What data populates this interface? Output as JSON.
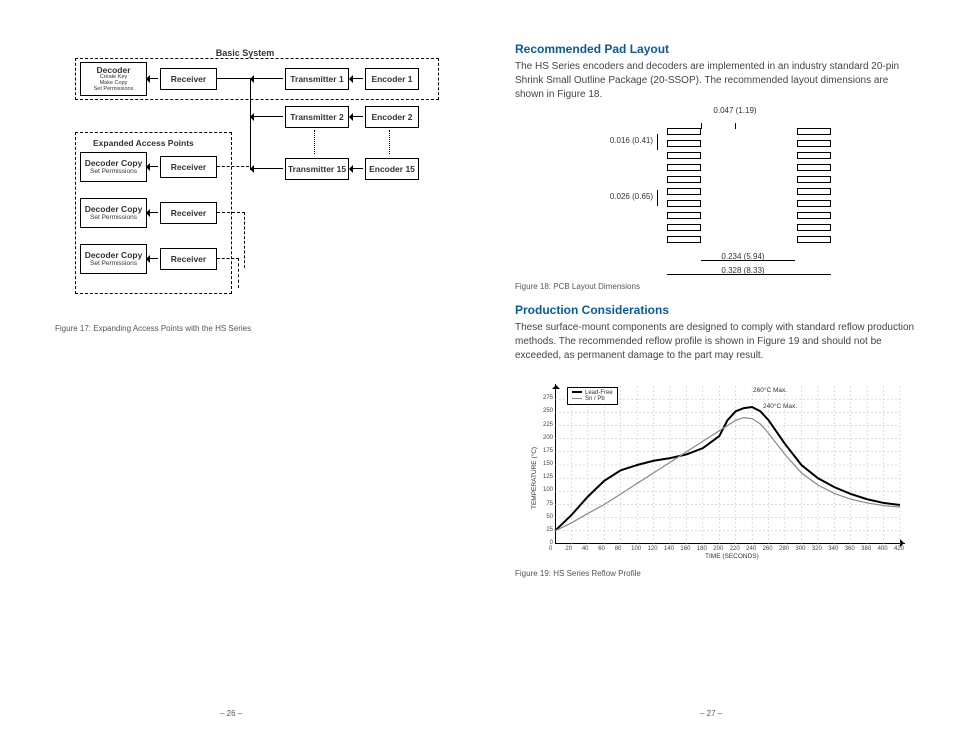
{
  "left": {
    "diagram_title": "Basic System",
    "expanded_label": "Expanded Access Points",
    "decoder": {
      "title": "Decoder",
      "lines": "Create Key\nMake Copy\nSet Permissions"
    },
    "decoder_copy": {
      "title": "Decoder Copy",
      "sub": "Set Permissions"
    },
    "receiver": "Receiver",
    "tx": [
      {
        "label": "Transmitter 1",
        "enc": "Encoder 1"
      },
      {
        "label": "Transmitter 2",
        "enc": "Encoder 2"
      },
      {
        "label": "Transmitter 15",
        "enc": "Encoder 15"
      }
    ],
    "caption": "Figure 17: Expanding Access Points with the HS Series",
    "pagenum": "– 26 –"
  },
  "right": {
    "h1": "Recommended Pad Layout",
    "p1": "The HS Series encoders and decoders are implemented in an industry standard 20-pin Shrink Small Outline Package (20-SSOP). The recommended layout dimensions are shown in Figure 18.",
    "dims": {
      "w": "0.047 (1.19)",
      "pitch": "0.016 (0.41)",
      "h": "0.026 (0.65)",
      "gap": "0.234 (5.94)",
      "overall": "0.328 (8.33)"
    },
    "fig18": "Figure 18: PCB Layout Dimensions",
    "h2": "Production Considerations",
    "p2": "These surface-mount components are designed to comply with standard reflow production methods. The recommended reflow profile is shown in Figure 19 and should not be exceeded, as permanent damage to the part may result.",
    "legend": {
      "a": "Lead-Free",
      "b": "Sn / Pb"
    },
    "peak1": "260°C Max.",
    "peak2": "240°C Max.",
    "ylabel": "TEMPERATURE (°C)",
    "xlabel": "TIME (SECONDS)",
    "fig19": "Figure 19: HS Series Reflow Profile",
    "pagenum": "– 27 –"
  },
  "chart_data": {
    "type": "line",
    "title": "HS Series Reflow Profile",
    "xlabel": "TIME (SECONDS)",
    "ylabel": "TEMPERATURE (°C)",
    "xlim": [
      0,
      420
    ],
    "ylim": [
      0,
      300
    ],
    "xticks": [
      0,
      20,
      40,
      60,
      80,
      100,
      120,
      140,
      160,
      180,
      200,
      220,
      240,
      260,
      280,
      300,
      320,
      340,
      360,
      380,
      400,
      420
    ],
    "yticks": [
      0,
      25,
      50,
      75,
      100,
      125,
      150,
      175,
      200,
      225,
      250,
      275
    ],
    "grid": true,
    "legend": [
      "Lead-Free",
      "Sn / Pb"
    ],
    "annotations": [
      {
        "text": "260°C Max.",
        "x": 240,
        "y": 260
      },
      {
        "text": "240°C Max.",
        "x": 250,
        "y": 240
      }
    ],
    "series": [
      {
        "name": "Lead-Free",
        "x": [
          0,
          20,
          40,
          60,
          80,
          100,
          120,
          140,
          160,
          180,
          200,
          210,
          220,
          230,
          240,
          250,
          260,
          280,
          300,
          320,
          340,
          360,
          380,
          400,
          420
        ],
        "y": [
          25,
          55,
          90,
          120,
          140,
          150,
          158,
          163,
          170,
          182,
          205,
          235,
          252,
          258,
          260,
          252,
          235,
          190,
          150,
          125,
          108,
          95,
          85,
          78,
          74
        ]
      },
      {
        "name": "Sn / Pb",
        "x": [
          0,
          20,
          40,
          60,
          80,
          100,
          120,
          140,
          160,
          180,
          200,
          220,
          230,
          240,
          250,
          260,
          280,
          300,
          320,
          340,
          360,
          380,
          400,
          420
        ],
        "y": [
          25,
          40,
          58,
          75,
          95,
          115,
          135,
          155,
          175,
          195,
          215,
          235,
          240,
          238,
          228,
          210,
          170,
          135,
          112,
          96,
          85,
          78,
          73,
          70
        ]
      }
    ]
  }
}
